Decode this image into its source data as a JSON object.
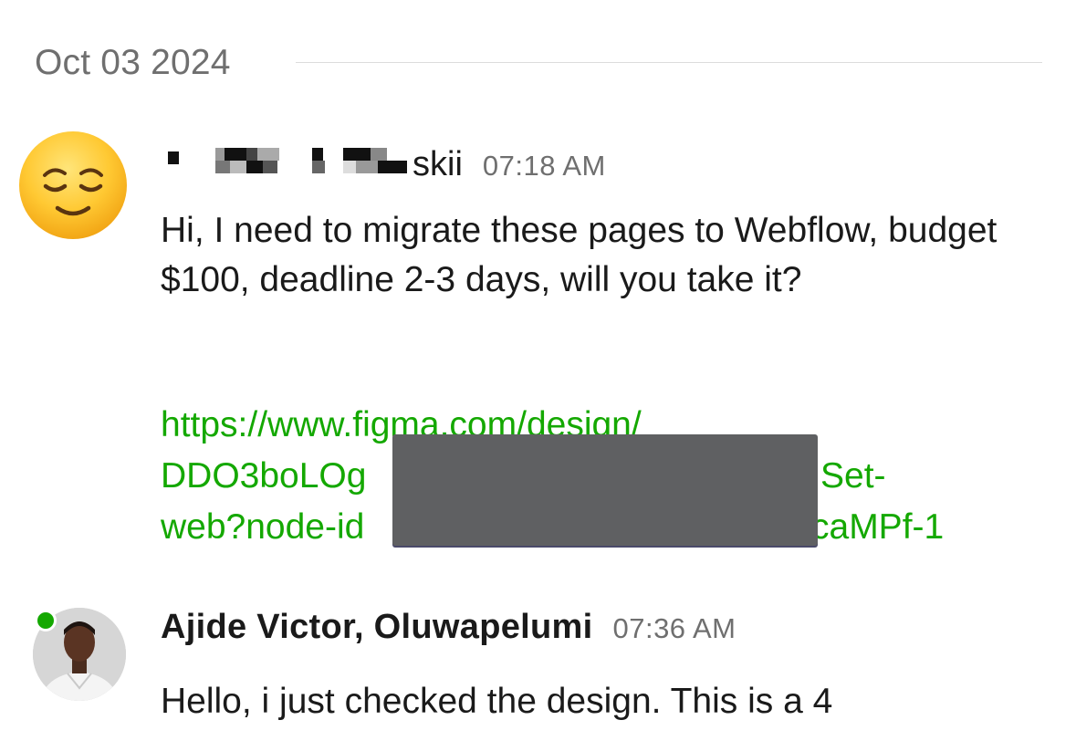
{
  "date_separator": {
    "label": "Oct 03 2024"
  },
  "messages": [
    {
      "sender_visible_suffix": "skii",
      "time": "07:18 AM",
      "avatar_icon": "relieved-face-emoji-icon",
      "text": "Hi, I need to migrate these pages to Webflow, budget $100, deadline 2-3 days, will you take it?",
      "link_lines": [
        {
          "left": "https://www.figma.com/design/",
          "right": ""
        },
        {
          "left": "DDO3boLOg",
          "right": "Set-"
        },
        {
          "left": "web?node-id",
          "right": "caMPf-1"
        }
      ]
    },
    {
      "sender": "Ajide Victor, Oluwapelumi",
      "time": "07:36 AM",
      "avatar_icon": "profile-photo-avatar",
      "online": true,
      "text": "Hello, i just checked the design. This is a 4"
    }
  ],
  "colors": {
    "link": "#14a800",
    "online": "#14a800",
    "muted_text": "#6f6f6f",
    "redaction": "#5f6062"
  }
}
